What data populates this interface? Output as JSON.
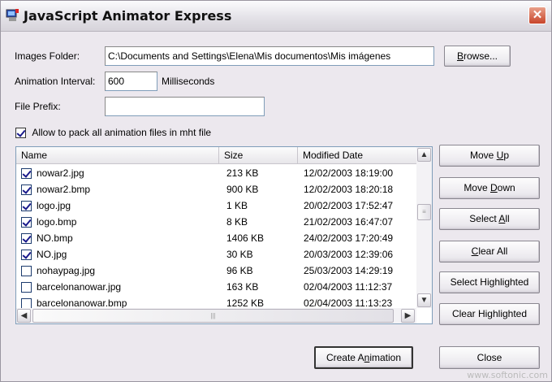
{
  "window": {
    "title": "JavaScript Animator Express"
  },
  "form": {
    "images_folder_label": "Images Folder:",
    "images_folder_value": "C:\\Documents and Settings\\Elena\\Mis documentos\\Mis imágenes",
    "browse_label": "Browse...",
    "interval_label": "Animation Interval:",
    "interval_value": "600",
    "interval_unit": "Milliseconds",
    "prefix_label": "File Prefix:",
    "prefix_value": "",
    "pack_label": "Allow to pack all animation files in mht file",
    "pack_checked": true
  },
  "list": {
    "columns": [
      "Name",
      "Size",
      "Modified Date"
    ],
    "rows": [
      {
        "name": "nowar2.jpg",
        "size": "213 KB",
        "date": "12/02/2003 18:19:00",
        "checked": true
      },
      {
        "name": "nowar2.bmp",
        "size": "900 KB",
        "date": "12/02/2003 18:20:18",
        "checked": true
      },
      {
        "name": "logo.jpg",
        "size": "1 KB",
        "date": "20/02/2003 17:52:47",
        "checked": true
      },
      {
        "name": "logo.bmp",
        "size": "8 KB",
        "date": "21/02/2003 16:47:07",
        "checked": true
      },
      {
        "name": "NO.bmp",
        "size": "1406 KB",
        "date": "24/02/2003 17:20:49",
        "checked": true
      },
      {
        "name": "NO.jpg",
        "size": "30 KB",
        "date": "20/03/2003 12:39:06",
        "checked": true
      },
      {
        "name": "nohaypag.jpg",
        "size": "96 KB",
        "date": "25/03/2003 14:29:19",
        "checked": false
      },
      {
        "name": "barcelonanowar.jpg",
        "size": "163 KB",
        "date": "02/04/2003 11:12:37",
        "checked": false
      },
      {
        "name": "barcelonanowar.bmp",
        "size": "1252 KB",
        "date": "02/04/2003 11:13:23",
        "checked": false
      }
    ]
  },
  "side_buttons": [
    {
      "pre": "Move ",
      "u": "U",
      "post": "p"
    },
    {
      "pre": "Move ",
      "u": "D",
      "post": "own"
    },
    {
      "pre": "Select ",
      "u": "A",
      "post": "ll"
    },
    {
      "pre": "",
      "u": "C",
      "post": "lear All"
    },
    {
      "pre": "Select Highlighted",
      "u": "",
      "post": ""
    },
    {
      "pre": "Clear Highlighted",
      "u": "",
      "post": ""
    }
  ],
  "footer": {
    "create_pre": "Create A",
    "create_u": "n",
    "create_post": "imation",
    "close_label": "Close"
  },
  "watermark": "www.softonic.com"
}
